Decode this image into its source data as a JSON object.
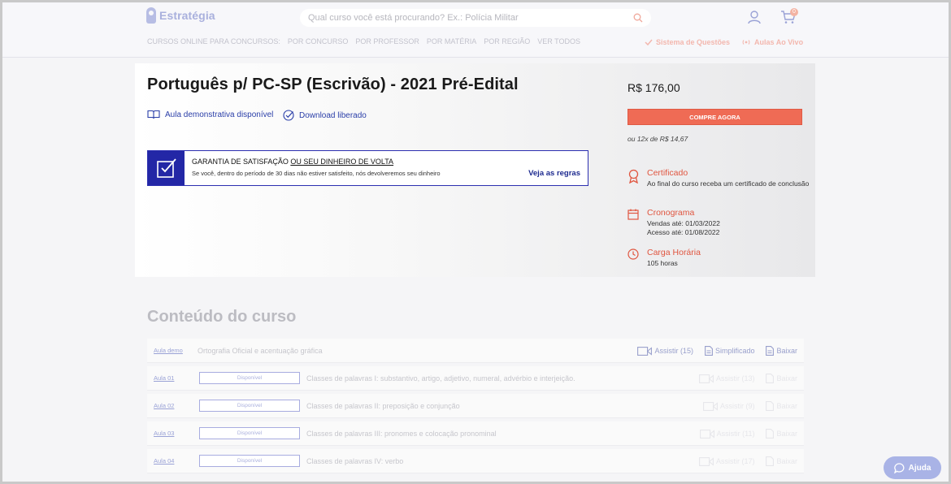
{
  "header": {
    "logo_text": "Estratégia",
    "search_placeholder": "Qual curso você está procurando? Ex.: Polícia Militar",
    "cart_count": "0",
    "nav_lead": "CURSOS ONLINE PARA CONCURSOS:",
    "nav_items": [
      "POR CONCURSO",
      "POR PROFESSOR",
      "POR MATÉRIA",
      "POR REGIÃO",
      "VER TODOS"
    ],
    "link_questions": "Sistema de Questões",
    "link_live": "Aulas Ao Vivo"
  },
  "course": {
    "title": "Português p/ PC-SP (Escrivão) - 2021 Pré-Edital",
    "feature_demo": "Aula demonstrativa disponível",
    "feature_download": "Download liberado",
    "guarantee_title_prefix": "GARANTIA DE SATISFAÇÃO ",
    "guarantee_title_underlined": "OU SEU DINHEIRO DE VOLTA",
    "guarantee_desc": "Se você, dentro do período de 30 dias não estiver satisfeito, nós devolveremos seu dinheiro",
    "guarantee_link": "Veja as regras",
    "price": "R$ 176,00",
    "buy_label": "COMPRE AGORA",
    "installments": "ou 12x de R$ 14,67",
    "certificate_title": "Certificado",
    "certificate_text": "Ao final do curso receba um certificado de conclusão",
    "schedule_title": "Cronograma",
    "schedule_sales": "Vendas até: 01/03/2022",
    "schedule_access": "Acesso até: 01/08/2022",
    "workload_title": "Carga Horária",
    "workload_text": "105 horas"
  },
  "content": {
    "title": "Conteúdo do curso",
    "lessons": [
      {
        "num": "Aula demo",
        "name": "Ortografia Oficial e acentuação gráfica",
        "watch": "Assistir (15)",
        "simplified": "Simplificado",
        "download": "Baixar"
      },
      {
        "num": "Aula 01",
        "status": "Disponível",
        "name": "Classes de palavras I: substantivo, artigo, adjetivo, numeral, advérbio e interjeição.",
        "watch": "Assistir (13)",
        "download": "Baixar"
      },
      {
        "num": "Aula 02",
        "status": "Disponível",
        "name": "Classes de palavras II: preposição e conjunção",
        "watch": "Assistir (9)",
        "download": "Baixar"
      },
      {
        "num": "Aula 03",
        "status": "Disponível",
        "name": "Classes de palavras III: pronomes e colocação pronominal",
        "watch": "Assistir (11)",
        "download": "Baixar"
      },
      {
        "num": "Aula 04",
        "status": "Disponível",
        "name": "Classes de palavras IV: verbo",
        "watch": "Assistir (17)",
        "download": "Baixar"
      }
    ]
  },
  "help_label": "Ajuda",
  "colors": {
    "accent": "#ef6b55",
    "brand": "#2327a6"
  }
}
